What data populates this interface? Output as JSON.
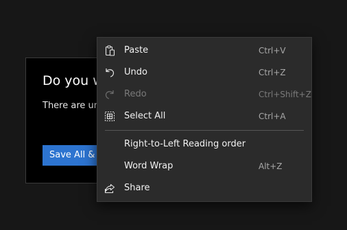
{
  "dialog": {
    "title": "Do you w",
    "message": "There are un",
    "primary_button": "Save All &"
  },
  "menu": {
    "items": [
      {
        "label": "Paste",
        "accelerator": "Ctrl+V",
        "icon": "paste-icon",
        "enabled": true
      },
      {
        "label": "Undo",
        "accelerator": "Ctrl+Z",
        "icon": "undo-icon",
        "enabled": true
      },
      {
        "label": "Redo",
        "accelerator": "Ctrl+Shift+Z",
        "icon": "redo-icon",
        "enabled": false
      },
      {
        "label": "Select All",
        "accelerator": "Ctrl+A",
        "icon": "select-all-icon",
        "enabled": true
      },
      {
        "label": "Right-to-Left Reading order",
        "accelerator": "",
        "icon": "",
        "enabled": true
      },
      {
        "label": "Word Wrap",
        "accelerator": "Alt+Z",
        "icon": "",
        "enabled": true
      },
      {
        "label": "Share",
        "accelerator": "",
        "icon": "share-icon",
        "enabled": true
      }
    ]
  },
  "colors": {
    "background": "#171717",
    "menu_background": "#2b2b2b",
    "accent": "#2d74d0",
    "disabled_text": "#7a7a7a"
  }
}
